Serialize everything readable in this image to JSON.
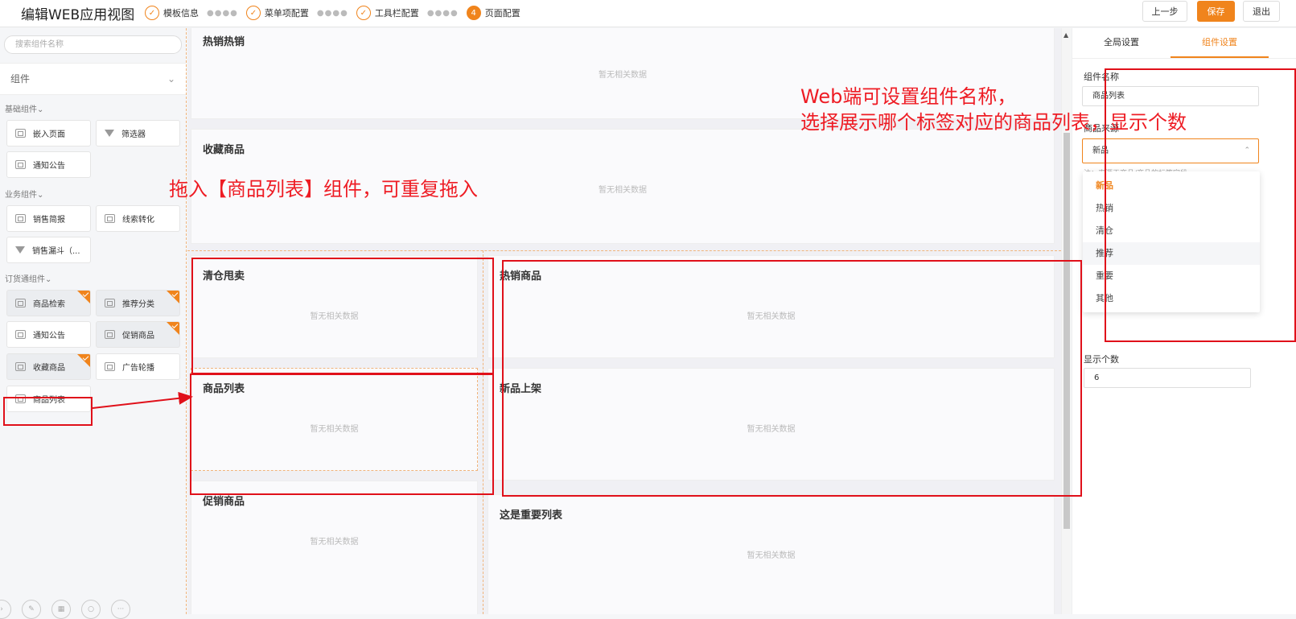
{
  "topbar": {
    "title": "编辑WEB应用视图",
    "steps": [
      {
        "label": "模板信息",
        "icon": "check-circle-icon"
      },
      {
        "label": "菜单项配置",
        "icon": "check-circle-icon"
      },
      {
        "label": "工具栏配置",
        "icon": "check-circle-icon"
      },
      {
        "label": "页面配置",
        "num": "4"
      }
    ],
    "buttons": {
      "prev": "上一步",
      "save": "保存",
      "exit": "退出"
    },
    "accent": "#f0841c"
  },
  "left": {
    "search_placeholder": "搜索组件名称",
    "group_select": "组件",
    "categories": [
      {
        "name": "基础组件",
        "items": [
          "嵌入页面",
          "筛选器",
          "通知公告"
        ]
      },
      {
        "name": "业务组件",
        "items": [
          "销售简报",
          "线索转化",
          "销售漏斗（..."
        ]
      },
      {
        "name": "订货通组件",
        "items": [
          "商品检索",
          "推荐分类",
          "通知公告",
          "促销商品",
          "收藏商品",
          "广告轮播",
          "商品列表"
        ]
      }
    ],
    "footer_icons": [
      "arrow-icon",
      "brush-icon",
      "layout-icon",
      "search-icon",
      "more-icon"
    ]
  },
  "canvas": {
    "empty_text": "暂无相关数据",
    "cards": [
      "热销热销",
      "收藏商品",
      "清仓甩卖",
      "商品列表",
      "促销商品",
      "热销商品",
      "新品上架",
      "这是重要列表"
    ]
  },
  "right": {
    "tabs": [
      "全局设置",
      "组件设置"
    ],
    "name_label": "组件名称",
    "name_value": "商品列表",
    "source_label": "商品来源",
    "source_value": "新品",
    "hint": "注：来源于商品/商品的标签字段",
    "options": [
      "新品",
      "热销",
      "清仓",
      "推荐",
      "重要",
      "其他"
    ],
    "count_label": "显示个数",
    "count_value": "6"
  },
  "annotations": {
    "drag": "拖入【商品列表】组件，可重复拖入",
    "web_line1": "Web端可设置组件名称，",
    "web_line2": "选择展示哪个标签对应的商品列表，显示个数",
    "color": "#e0101a"
  }
}
